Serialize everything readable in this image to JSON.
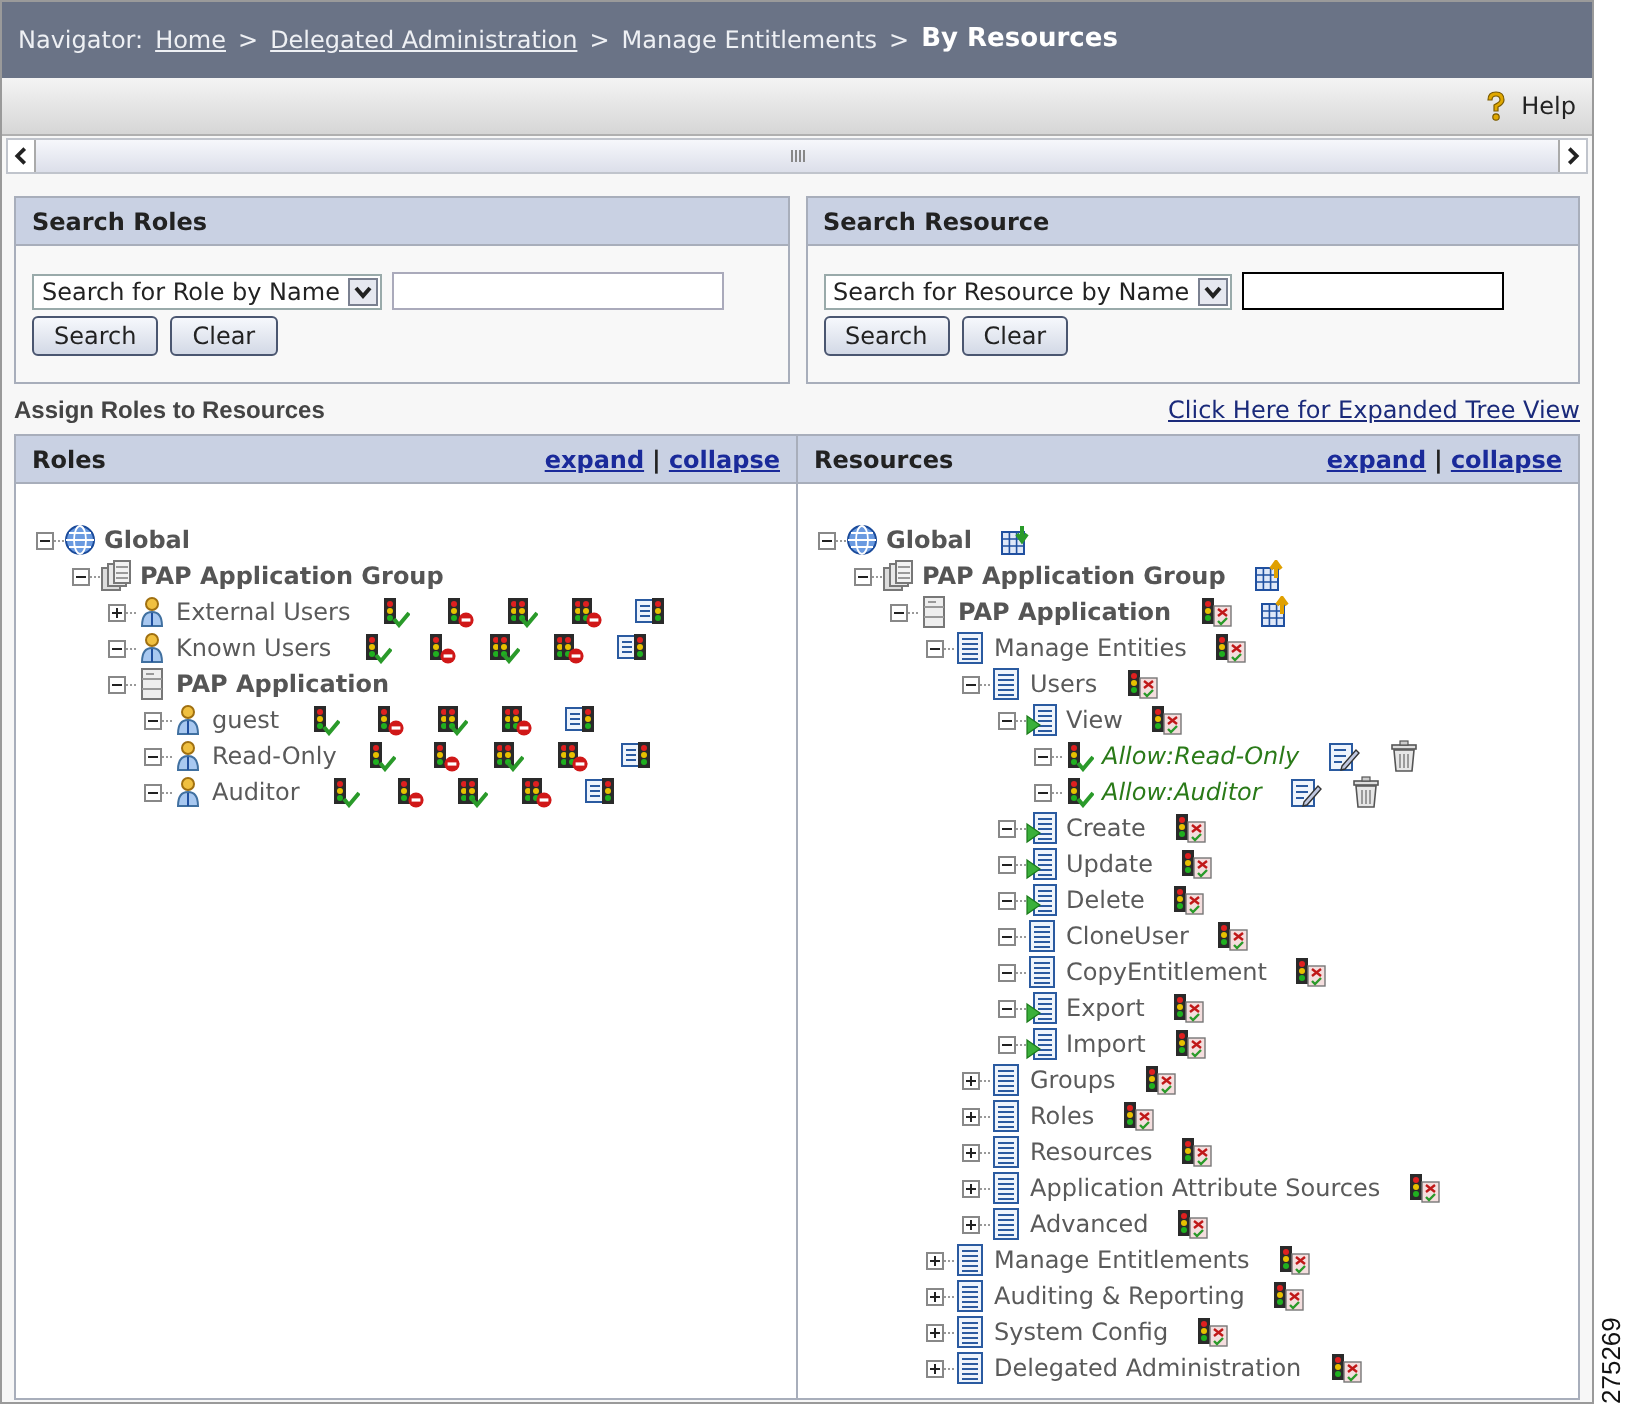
{
  "navigator": {
    "label": "Navigator:",
    "separator": ">",
    "items": [
      {
        "label": "Home",
        "kind": "link"
      },
      {
        "label": "Delegated Administration",
        "kind": "link"
      },
      {
        "label": "Manage Entitlements",
        "kind": "text"
      },
      {
        "label": "By Resources",
        "kind": "current"
      }
    ]
  },
  "toolbar": {
    "help": "Help"
  },
  "search_panels": [
    {
      "title": "Search Roles",
      "select": "Search for Role by Name",
      "focused": false,
      "buttons": [
        "Search",
        "Clear"
      ]
    },
    {
      "title": "Search Resource",
      "select": "Search for Resource by Name",
      "focused": true,
      "buttons": [
        "Search",
        "Clear"
      ]
    }
  ],
  "section_title": "Assign Roles to Resources",
  "tree_view_link": "Click Here for Expanded Tree View",
  "tree_panels": [
    {
      "title": "Roles",
      "links": [
        "expand",
        "collapse"
      ],
      "separator": "|",
      "tree": [
        {
          "label": "Global",
          "kind": "globe",
          "expanded": true,
          "children": [
            {
              "label": "PAP Application Group",
              "kind": "group",
              "expanded": true,
              "children": [
                {
                  "label": "External Users",
                  "kind": "user",
                  "expanded": false,
                  "actions": [
                    {
                      "kind": "grant"
                    },
                    {
                      "kind": "deny"
                    },
                    {
                      "kind": "grant-all"
                    },
                    {
                      "kind": "deny-all"
                    },
                    {
                      "kind": "list"
                    }
                  ]
                },
                {
                  "label": "Known Users",
                  "kind": "user",
                  "expanded": true,
                  "actions": [
                    {
                      "kind": "grant"
                    },
                    {
                      "kind": "deny"
                    },
                    {
                      "kind": "grant-all"
                    },
                    {
                      "kind": "deny-all"
                    },
                    {
                      "kind": "list"
                    }
                  ]
                },
                {
                  "label": "PAP Application",
                  "kind": "application",
                  "expanded": true,
                  "children": [
                    {
                      "label": "guest",
                      "kind": "user",
                      "expanded": true,
                      "actions": [
                        {
                          "kind": "grant"
                        },
                        {
                          "kind": "deny"
                        },
                        {
                          "kind": "grant-all"
                        },
                        {
                          "kind": "deny-all"
                        },
                        {
                          "kind": "list"
                        }
                      ]
                    },
                    {
                      "label": "Read-Only",
                      "kind": "user",
                      "expanded": true,
                      "actions": [
                        {
                          "kind": "grant"
                        },
                        {
                          "kind": "deny"
                        },
                        {
                          "kind": "grant-all"
                        },
                        {
                          "kind": "deny-all"
                        },
                        {
                          "kind": "list"
                        }
                      ]
                    },
                    {
                      "label": "Auditor",
                      "kind": "user",
                      "expanded": true,
                      "actions": [
                        {
                          "kind": "grant"
                        },
                        {
                          "kind": "deny"
                        },
                        {
                          "kind": "grant-all"
                        },
                        {
                          "kind": "deny-all"
                        },
                        {
                          "kind": "list"
                        }
                      ]
                    }
                  ]
                }
              ]
            }
          ]
        }
      ]
    },
    {
      "title": "Resources",
      "links": [
        "expand",
        "collapse"
      ],
      "separator": "|",
      "tree": [
        {
          "label": "Global",
          "kind": "globe",
          "expanded": true,
          "actions": [
            {
              "kind": "import"
            }
          ],
          "children": [
            {
              "label": "PAP Application Group",
              "kind": "group",
              "expanded": true,
              "actions": [
                {
                  "kind": "export"
                }
              ],
              "children": [
                {
                  "label": "PAP Application",
                  "kind": "application",
                  "expanded": true,
                  "actions": [
                    {
                      "kind": "policy"
                    },
                    {
                      "kind": "export"
                    }
                  ],
                  "children": [
                    {
                      "label": "Manage Entities",
                      "kind": "page",
                      "expanded": true,
                      "actions": [
                        {
                          "kind": "policy"
                        }
                      ],
                      "children": [
                        {
                          "label": "Users",
                          "kind": "page",
                          "expanded": true,
                          "actions": [
                            {
                              "kind": "policy"
                            }
                          ],
                          "children": [
                            {
                              "label": "View",
                              "kind": "action",
                              "expanded": true,
                              "actions": [
                                {
                                  "kind": "policy"
                                }
                              ],
                              "children": [
                                {
                                  "label": "Allow:Read-Only",
                                  "kind": "allow",
                                  "expanded": true,
                                  "actions": [
                                    {
                                      "kind": "edit"
                                    },
                                    {
                                      "kind": "delete"
                                    }
                                  ]
                                },
                                {
                                  "label": "Allow:Auditor",
                                  "kind": "allow",
                                  "expanded": true,
                                  "actions": [
                                    {
                                      "kind": "edit"
                                    },
                                    {
                                      "kind": "delete"
                                    }
                                  ]
                                }
                              ]
                            },
                            {
                              "label": "Create",
                              "kind": "action",
                              "expanded": true,
                              "actions": [
                                {
                                  "kind": "policy"
                                }
                              ]
                            },
                            {
                              "label": "Update",
                              "kind": "action",
                              "expanded": true,
                              "actions": [
                                {
                                  "kind": "policy"
                                }
                              ]
                            },
                            {
                              "label": "Delete",
                              "kind": "action",
                              "expanded": true,
                              "actions": [
                                {
                                  "kind": "policy"
                                }
                              ]
                            },
                            {
                              "label": "CloneUser",
                              "kind": "page",
                              "expanded": true,
                              "actions": [
                                {
                                  "kind": "policy"
                                }
                              ]
                            },
                            {
                              "label": "CopyEntitlement",
                              "kind": "page",
                              "expanded": true,
                              "actions": [
                                {
                                  "kind": "policy"
                                }
                              ]
                            },
                            {
                              "label": "Export",
                              "kind": "action",
                              "expanded": true,
                              "actions": [
                                {
                                  "kind": "policy"
                                }
                              ]
                            },
                            {
                              "label": "Import",
                              "kind": "action",
                              "expanded": true,
                              "actions": [
                                {
                                  "kind": "policy"
                                }
                              ]
                            }
                          ]
                        },
                        {
                          "label": "Groups",
                          "kind": "page",
                          "expanded": false,
                          "actions": [
                            {
                              "kind": "policy"
                            }
                          ]
                        },
                        {
                          "label": "Roles",
                          "kind": "page",
                          "expanded": false,
                          "actions": [
                            {
                              "kind": "policy"
                            }
                          ]
                        },
                        {
                          "label": "Resources",
                          "kind": "page",
                          "expanded": false,
                          "actions": [
                            {
                              "kind": "policy"
                            }
                          ]
                        },
                        {
                          "label": "Application Attribute Sources",
                          "kind": "page",
                          "expanded": false,
                          "actions": [
                            {
                              "kind": "policy"
                            }
                          ]
                        },
                        {
                          "label": "Advanced",
                          "kind": "page",
                          "expanded": false,
                          "actions": [
                            {
                              "kind": "policy"
                            }
                          ]
                        }
                      ]
                    },
                    {
                      "label": "Manage Entitlements",
                      "kind": "page",
                      "expanded": false,
                      "actions": [
                        {
                          "kind": "policy"
                        }
                      ]
                    },
                    {
                      "label": "Auditing & Reporting",
                      "kind": "page",
                      "expanded": false,
                      "actions": [
                        {
                          "kind": "policy"
                        }
                      ]
                    },
                    {
                      "label": "System Config",
                      "kind": "page",
                      "expanded": false,
                      "actions": [
                        {
                          "kind": "policy"
                        }
                      ]
                    },
                    {
                      "label": "Delegated Administration",
                      "kind": "page",
                      "expanded": false,
                      "actions": [
                        {
                          "kind": "policy"
                        }
                      ]
                    }
                  ]
                }
              ]
            }
          ]
        }
      ]
    }
  ],
  "figure_number": "275269"
}
